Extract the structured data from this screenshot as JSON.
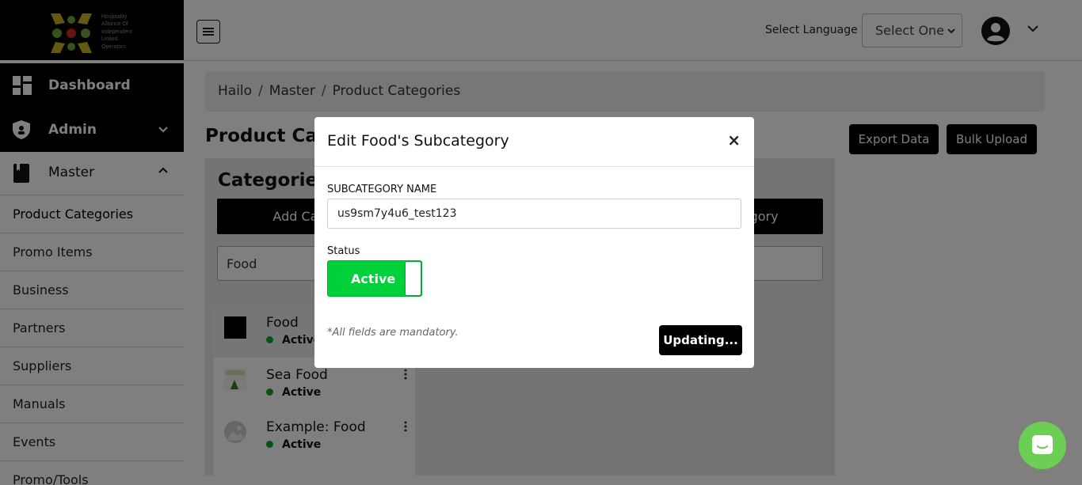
{
  "brand": {
    "logo_text_lines": [
      "Hospitality",
      "Alliance Of",
      "Independent",
      "Linked",
      "Operators"
    ]
  },
  "sidebar": {
    "dashboard_label": "Dashboard",
    "admin_label": "Admin",
    "master_label": "Master",
    "items": [
      {
        "label": "Product Categories"
      },
      {
        "label": "Promo Items"
      },
      {
        "label": "Business"
      },
      {
        "label": "Partners"
      },
      {
        "label": "Suppliers"
      },
      {
        "label": "Manuals"
      },
      {
        "label": "Events"
      },
      {
        "label": "Promo/Tools"
      }
    ]
  },
  "header": {
    "language_label": "Select Language",
    "language_select_value": "Select One"
  },
  "breadcrumb": {
    "items": [
      "Hailo",
      "Master",
      "Product Categories"
    ],
    "separator": "/"
  },
  "page": {
    "title": "Product Categories",
    "export_button": "Export Data",
    "bulk_upload_button": "Bulk Upload"
  },
  "categories_panel": {
    "title": "Categories",
    "add_category_button": "Add Category",
    "add_subcategory_button": "Add Subcategory",
    "search_value": "Food",
    "items": [
      {
        "name": "Food",
        "status": "Active"
      },
      {
        "name": "Sea Food",
        "status": "Active"
      },
      {
        "name": "Example: Food",
        "status": "Active"
      }
    ]
  },
  "modal": {
    "title": "Edit Food's Subcategory",
    "close_symbol": "×",
    "field_label": "SUBCATEGORY NAME",
    "field_value": "us9sm7y4u6_test123",
    "status_label": "Status",
    "status_value": "Active",
    "mandatory_note": "*All fields are mandatory.",
    "submit_button": "Updating..."
  },
  "colors": {
    "accent_black": "#000000",
    "active_green": "#00d03a",
    "status_dot": "#10a52b",
    "chat_launcher": "#6cce54"
  },
  "icons": [
    "dashboard-icon",
    "shield-icon",
    "book-icon",
    "chevron-down-icon",
    "chevron-up-icon",
    "hamburger-menu-icon",
    "user-avatar-icon",
    "close-icon",
    "kebab-menu-icon",
    "chat-icon"
  ]
}
